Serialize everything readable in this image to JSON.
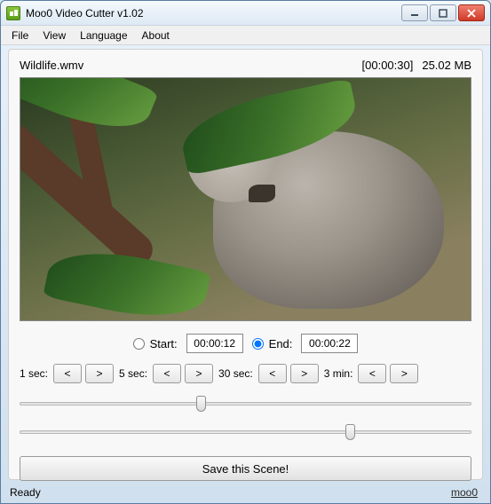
{
  "window": {
    "title": "Moo0 Video Cutter v1.02"
  },
  "menu": {
    "file": "File",
    "view": "View",
    "language": "Language",
    "about": "About"
  },
  "file": {
    "name": "Wildlife.wmv",
    "duration": "[00:00:30]",
    "size": "25.02 MB"
  },
  "startend": {
    "start_label": "Start:",
    "end_label": "End:",
    "start_value": "00:00:12",
    "end_value": "00:00:22",
    "selected": "end"
  },
  "steps": {
    "s1": "1 sec:",
    "s5": "5 sec:",
    "s30": "30 sec:",
    "m3": "3 min:",
    "back": "<",
    "fwd": ">"
  },
  "sliders": {
    "start_percent": 40,
    "end_percent": 73
  },
  "buttons": {
    "save": "Save this Scene!"
  },
  "status": {
    "text": "Ready",
    "brand": "moo0"
  }
}
